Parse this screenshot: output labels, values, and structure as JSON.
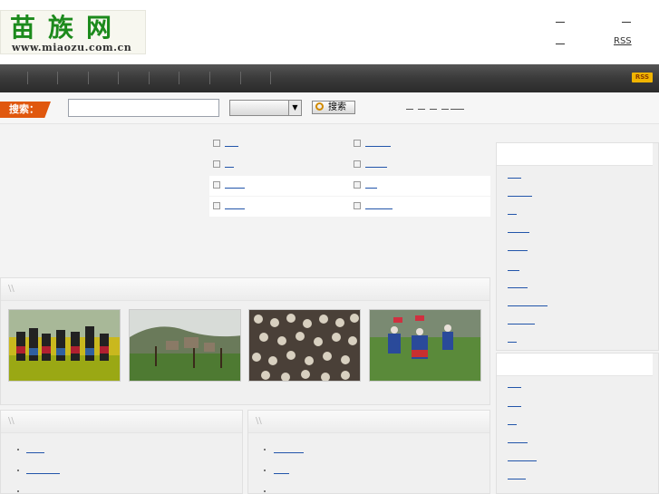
{
  "site": {
    "logo_cn": "苗族网",
    "logo_url": "www.miaozu.com.cn"
  },
  "header": {
    "rss_label": "RSS"
  },
  "nav": {
    "rss_badge": "RSS"
  },
  "search": {
    "label": "搜索：",
    "placeholder": "",
    "button_label": "搜索",
    "select_value": ""
  },
  "colors": {
    "logo_green": "#1c8a1c",
    "search_label_orange": "#e0580e",
    "nav_dark": "#3a3a3a",
    "rss_yellow": "#f0b400",
    "link_blue": "#2255aa"
  },
  "icons": {
    "search_button": "search-icon",
    "dropdown": "dropdown-arrow-icon",
    "bullets": "square-bullet-icon"
  },
  "photos": [
    {
      "name": "photo-flower-field-dancers"
    },
    {
      "name": "photo-village-landscape"
    },
    {
      "name": "photo-festival-crowd"
    },
    {
      "name": "photo-dance-performance"
    }
  ]
}
